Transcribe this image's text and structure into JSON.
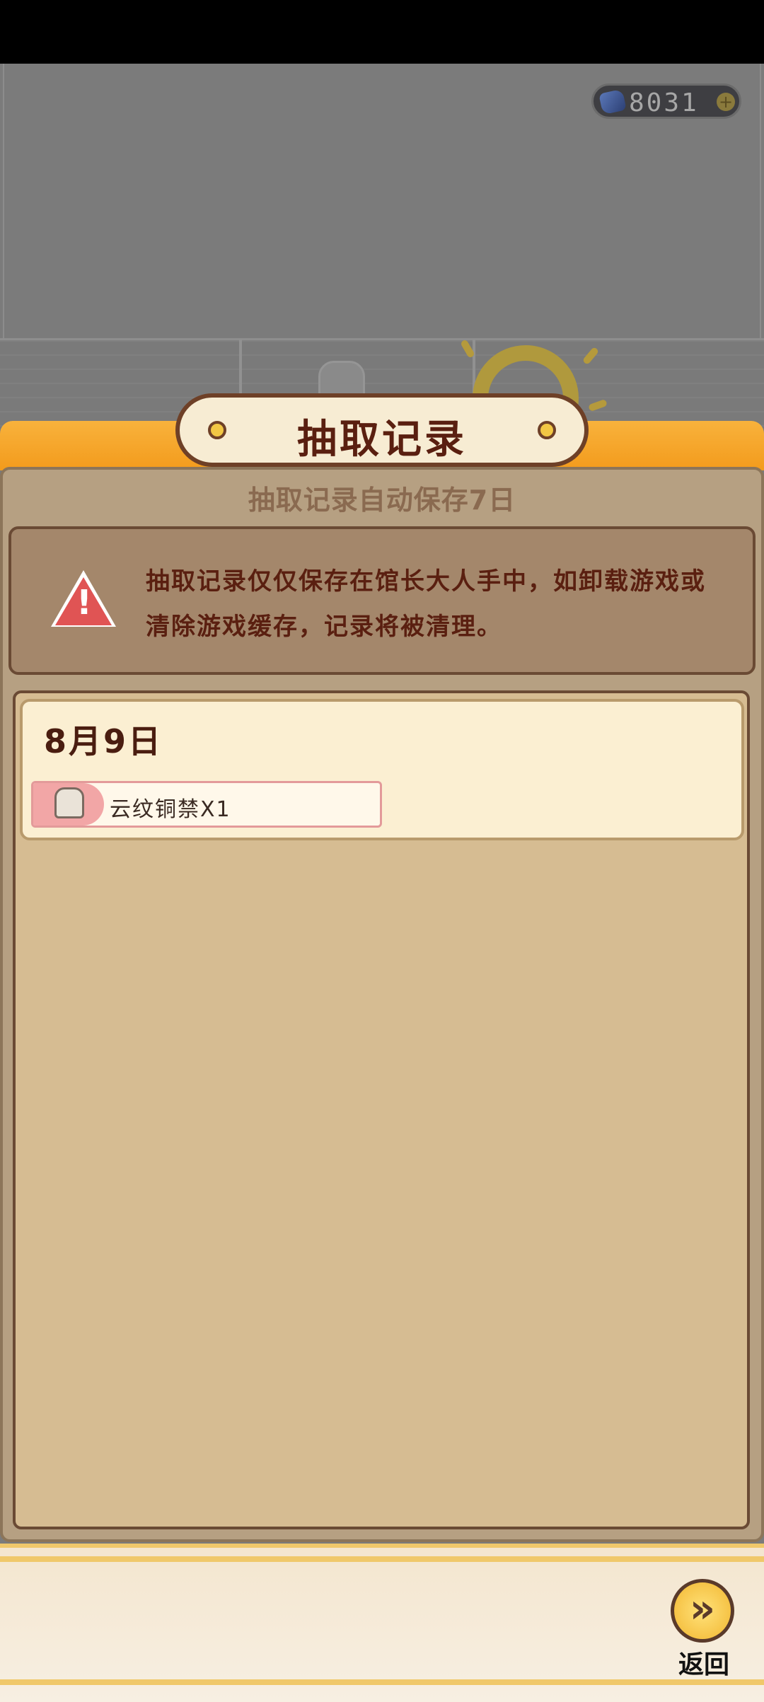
{
  "currency": {
    "value": "8031",
    "icon": "gem-icon",
    "add_icon": "plus-icon"
  },
  "dialog": {
    "title": "抽取记录",
    "subtitle": "抽取记录自动保存7日",
    "warning": {
      "icon": "warning-icon",
      "line1": "抽取记录仅仅保存在馆长大人手中，如卸载游戏或",
      "line2": "清除游戏缓存，记录将被清理。"
    }
  },
  "records": [
    {
      "date": "8月9日",
      "items": [
        {
          "icon": "bronze-vessel-icon",
          "label": "云纹铜禁X1"
        }
      ]
    }
  ],
  "footer": {
    "back_label": "返回",
    "back_icon": "chevron-right-icon"
  },
  "colors": {
    "accent": "#f39b1c",
    "panel": "#d6bc92",
    "title_text": "#5a1f10"
  }
}
